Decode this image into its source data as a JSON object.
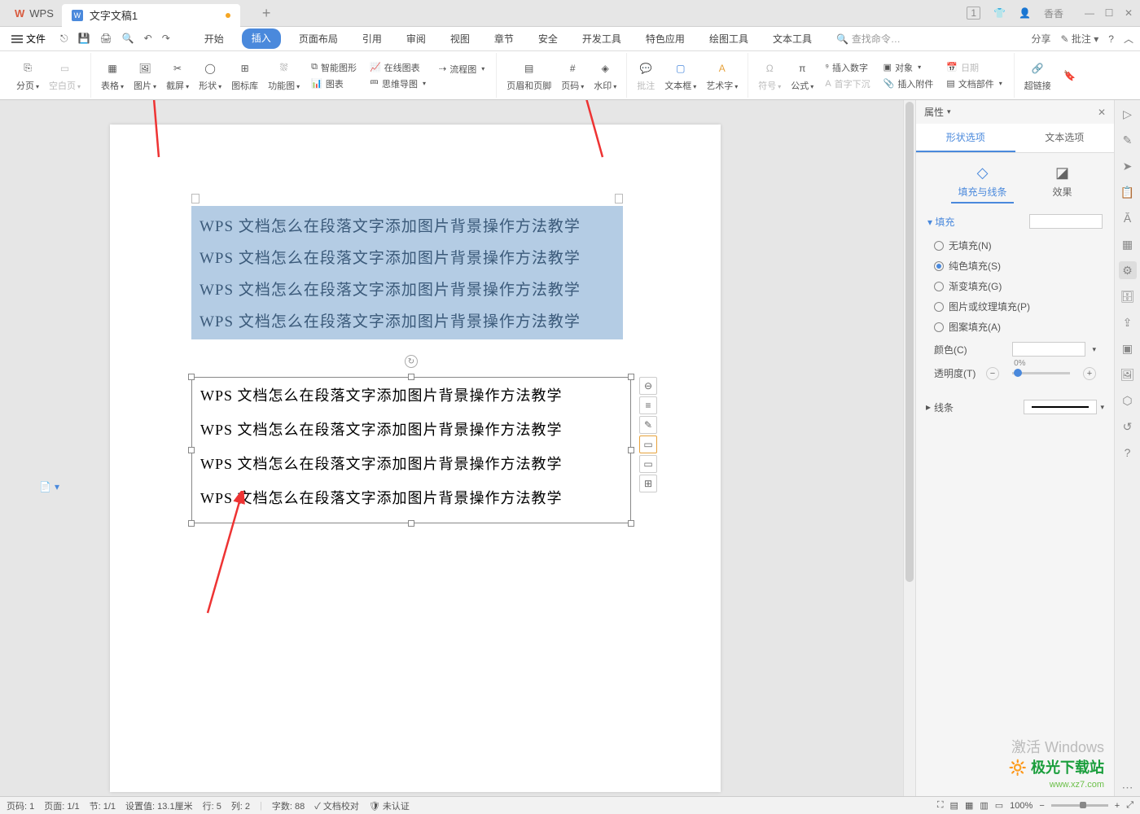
{
  "titlebar": {
    "app": "WPS",
    "doc_tab": "文字文稿1",
    "new_tab": "+",
    "badge": "1",
    "user": "香香"
  },
  "menubar": {
    "file": "文件",
    "tabs": [
      "开始",
      "插入",
      "页面布局",
      "引用",
      "审阅",
      "视图",
      "章节",
      "安全",
      "开发工具",
      "特色应用",
      "绘图工具",
      "文本工具"
    ],
    "active_tab": "插入",
    "search_placeholder": "查找命令…",
    "share": "分享",
    "pizhu": "批注"
  },
  "ribbon": {
    "fenye": "分页",
    "kbyy": "空白页",
    "biaoge": "表格",
    "tupian": "图片",
    "jietu": "截屏",
    "xingzhuang": "形状",
    "tubiaokr": "图标库",
    "gongneng": "功能图",
    "smart": "智能图形",
    "zxtb": "在线图表",
    "lct": "流程图",
    "tubiao": "图表",
    "swdt": "思维导图",
    "ymyj": "页眉和页脚",
    "yema": "页码",
    "shuiyin": "水印",
    "pizhu": "批注",
    "wenbenkuang": "文本框",
    "yishuzi": "艺术字",
    "fuhao": "符号",
    "gongshi": "公式",
    "crsz": "插入数字",
    "duixiang": "对象",
    "szxc": "首字下沉",
    "crfj": "插入附件",
    "riqi": "日期",
    "wdbj": "文档部件",
    "chalianjie": "超链接"
  },
  "document": {
    "line": "WPS 文档怎么在段落文字添加图片背景操作方法教学"
  },
  "panel": {
    "title": "属性",
    "tab_shape": "形状选项",
    "tab_text": "文本选项",
    "sub_fill": "填充与线条",
    "sub_effect": "效果",
    "fill_title": "填充",
    "fill_none": "无填充(N)",
    "fill_solid": "纯色填充(S)",
    "fill_gradient": "渐变填充(G)",
    "fill_picture": "图片或纹理填充(P)",
    "fill_pattern": "图案填充(A)",
    "color": "颜色(C)",
    "transparency": "透明度(T)",
    "transparency_val": "0%",
    "line_title": "线条"
  },
  "statusbar": {
    "page_no": "页码: 1",
    "page": "页面: 1/1",
    "section": "节: 1/1",
    "setval": "设置值: 13.1厘米",
    "row": "行: 5",
    "col": "列: 2",
    "words": "字数: 88",
    "proof": "文档校对",
    "unauth": "未认证",
    "zoom": "100%"
  },
  "watermark": {
    "activate": "激活 Windows",
    "site": "极光下载站",
    "url": "www.xz7.com"
  }
}
